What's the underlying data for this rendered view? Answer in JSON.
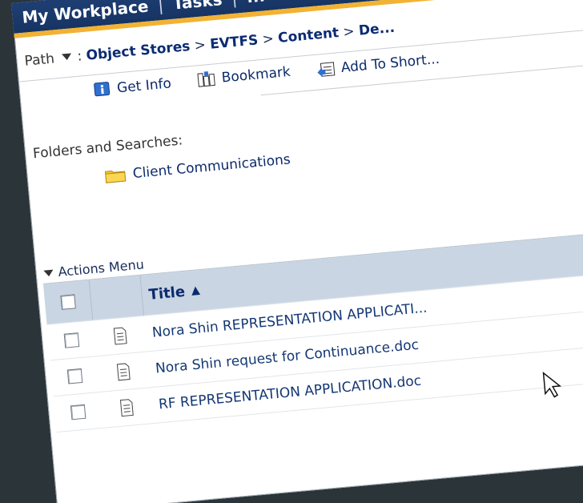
{
  "nav": {
    "items": [
      "My Workplace",
      "Tasks",
      "..."
    ]
  },
  "path": {
    "label": "Path",
    "crumbs": [
      "Object Stores",
      "EVTFS",
      "Content",
      "De..."
    ]
  },
  "toolbar": {
    "get_info": "Get Info",
    "bookmark": "Bookmark",
    "add_to_shortcuts": "Add To Short..."
  },
  "folders": {
    "label": "Folders and Searches:",
    "items": [
      {
        "name": "Client Communications",
        "icon": "folder-icon"
      }
    ]
  },
  "actions": {
    "label": "Actions Menu"
  },
  "table": {
    "title_header": "Title",
    "sort_glyph": "▲",
    "rows": [
      {
        "title": "Nora Shin REPRESENTATION APPLICATI...",
        "icon": "document-icon"
      },
      {
        "title": "Nora Shin request for Continuance.doc",
        "icon": "document-icon"
      },
      {
        "title": "RF REPRESENTATION APPLICATION.doc",
        "icon": "document-icon"
      }
    ]
  },
  "colors": {
    "nav_bg": "#163463",
    "nav_accent": "#f2b233",
    "header_row_bg": "#c9d5e2",
    "link_text": "#143774"
  }
}
